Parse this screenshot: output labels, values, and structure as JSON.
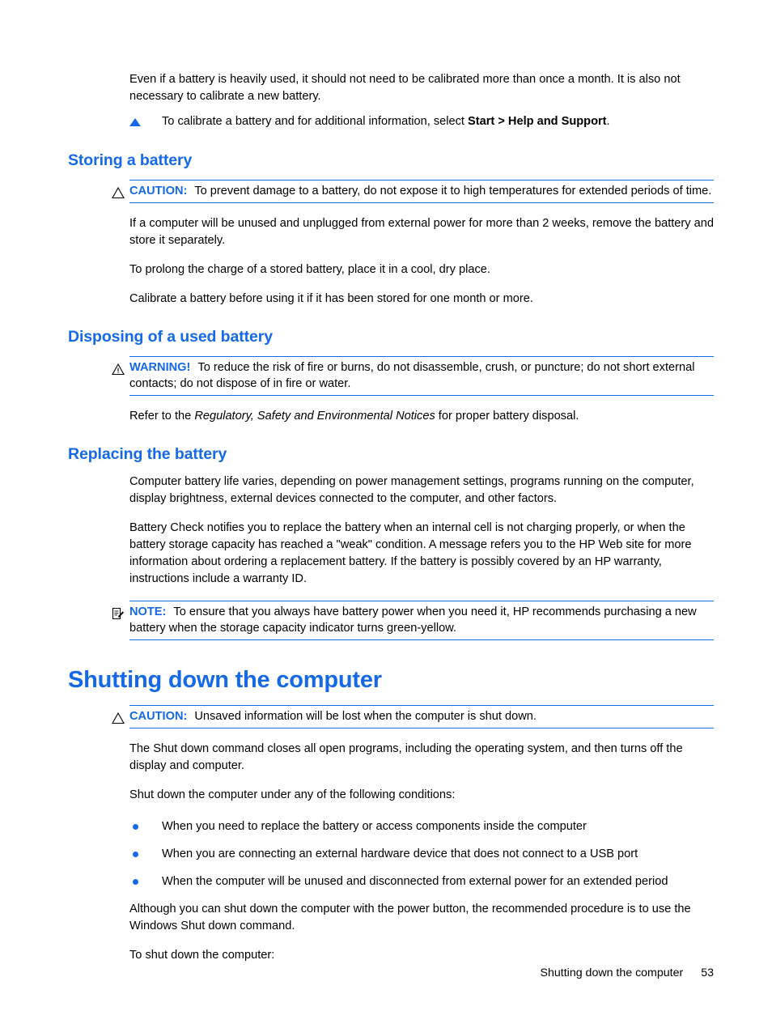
{
  "page": {
    "accent_blue": "#1569E6",
    "text_black": "#000000",
    "background": "#ffffff"
  },
  "intro": {
    "paragraph": "Even if a battery is heavily used, it should not need to be calibrated more than once a month. It is also not necessary to calibrate a new battery.",
    "step": {
      "marker_icon": "triangle-bullet-icon",
      "text_before": "To calibrate a battery and for additional information, select ",
      "bold_text": "Start > Help and Support",
      "text_after": "."
    }
  },
  "sections": {
    "storing": {
      "heading": "Storing a battery",
      "caution": {
        "icon": "caution-triangle-icon",
        "label": "CAUTION:",
        "text": "To prevent damage to a battery, do not expose it to high temperatures for extended periods of time."
      },
      "paragraphs": [
        "If a computer will be unused and unplugged from external power for more than 2 weeks, remove the battery and store it separately.",
        "To prolong the charge of a stored battery, place it in a cool, dry place.",
        "Calibrate a battery before using it if it has been stored for one month or more."
      ]
    },
    "disposing": {
      "heading": "Disposing of a used battery",
      "warning": {
        "icon": "warning-triangle-icon",
        "label": "WARNING!",
        "text": "To reduce the risk of fire or burns, do not disassemble, crush, or puncture; do not short external contacts; do not dispose of in fire or water."
      },
      "refer": {
        "before": "Refer to the ",
        "italic": "Regulatory, Safety and Environmental Notices",
        "after": " for proper battery disposal."
      }
    },
    "replacing": {
      "heading": "Replacing the battery",
      "paragraphs": [
        "Computer battery life varies, depending on power management settings, programs running on the computer, display brightness, external devices connected to the computer, and other factors.",
        "Battery Check notifies you to replace the battery when an internal cell is not charging properly, or when the battery storage capacity has reached a \"weak\" condition. A message refers you to the HP Web site for more information about ordering a replacement battery. If the battery is possibly covered by an HP warranty, instructions include a warranty ID."
      ],
      "note": {
        "icon": "note-document-icon",
        "label": "NOTE:",
        "text": "To ensure that you always have battery power when you need it, HP recommends purchasing a new battery when the storage capacity indicator turns green-yellow."
      }
    },
    "shutting_down": {
      "heading": "Shutting down the computer",
      "caution": {
        "icon": "caution-triangle-icon",
        "label": "CAUTION:",
        "text": "Unsaved information will be lost when the computer is shut down."
      },
      "paragraphs": [
        "The Shut down command closes all open programs, including the operating system, and then turns off the display and computer.",
        "Shut down the computer under any of the following conditions:"
      ],
      "conditions": [
        "When you need to replace the battery or access components inside the computer",
        "When you are connecting an external hardware device that does not connect to a USB port",
        "When the computer will be unused and disconnected from external power for an extended period"
      ],
      "closing_paragraphs": [
        "Although you can shut down the computer with the power button, the recommended procedure is to use the Windows Shut down command.",
        "To shut down the computer:"
      ]
    }
  },
  "footer": {
    "title": "Shutting down the computer",
    "page_number": "53"
  }
}
